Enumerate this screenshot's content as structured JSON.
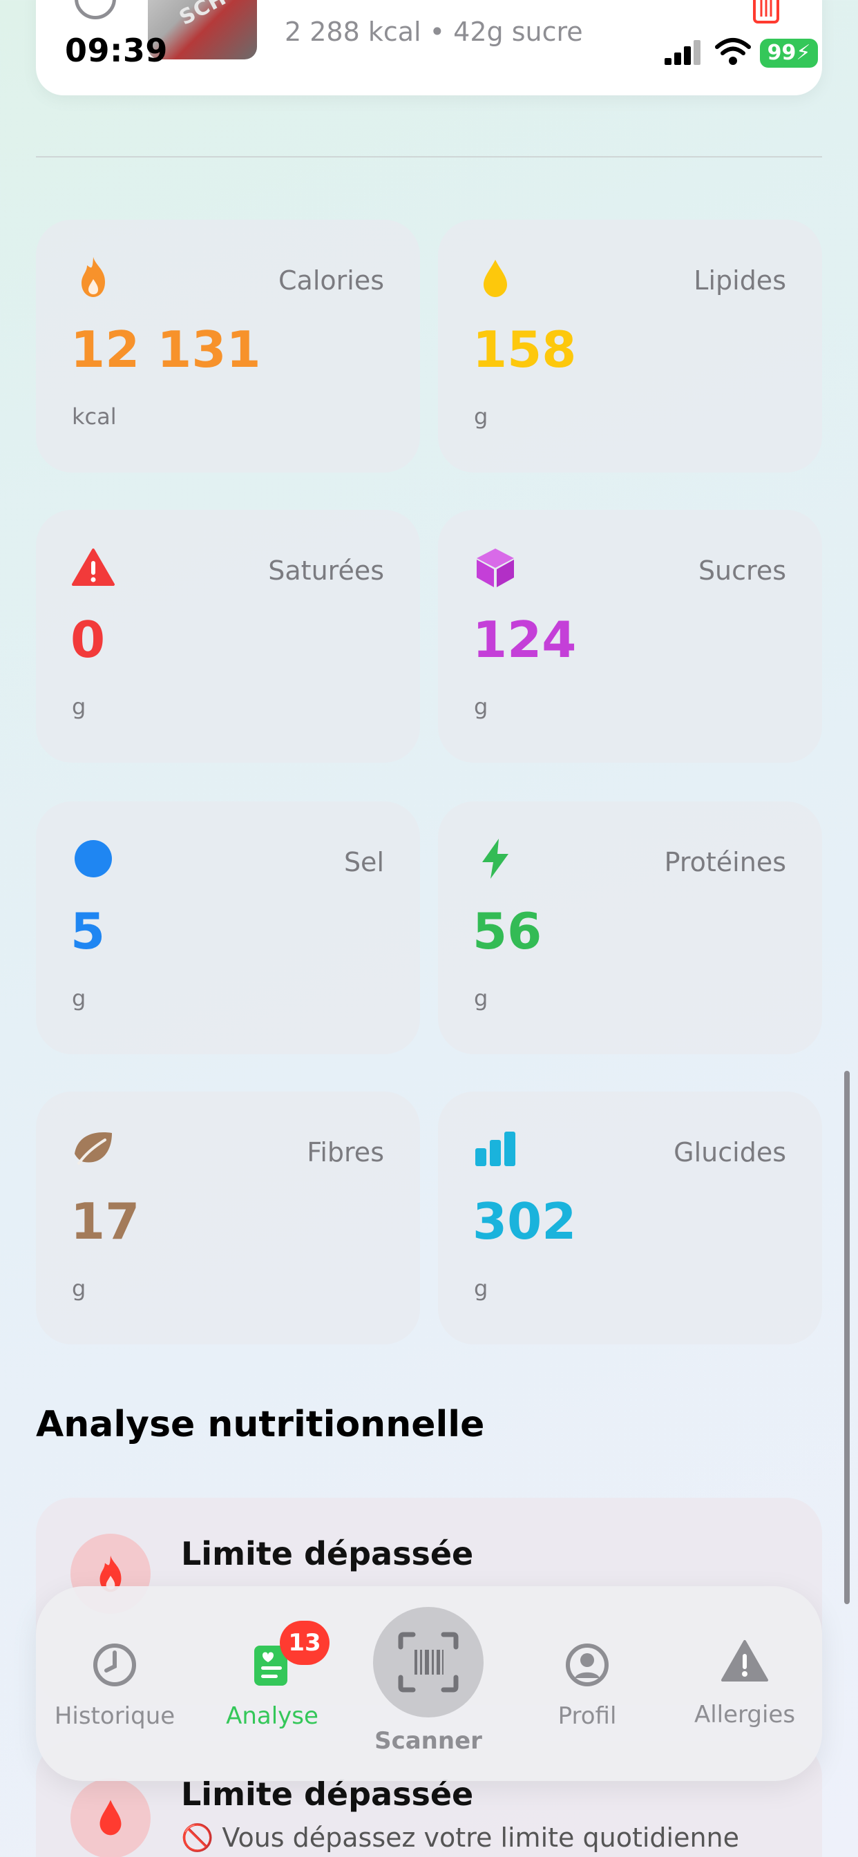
{
  "top_item": {
    "meta": "2 288 kcal • 42g sucre",
    "thumb_text": "SCH"
  },
  "status_bar": {
    "time": "09:39",
    "battery": "99"
  },
  "stats": [
    {
      "label": "Calories",
      "value": "12 131",
      "unit": "kcal",
      "color": "#f7922b",
      "icon": "flame-icon"
    },
    {
      "label": "Lipides",
      "value": "158",
      "unit": "g",
      "color": "#fdc80c",
      "icon": "drop-icon"
    },
    {
      "label": "Saturées",
      "value": "0",
      "unit": "g",
      "color": "#f23a3a",
      "icon": "warning-icon"
    },
    {
      "label": "Sucres",
      "value": "124",
      "unit": "g",
      "color": "#c43fd8",
      "icon": "cube-icon"
    },
    {
      "label": "Sel",
      "value": "5",
      "unit": "g",
      "color": "#1f86f2",
      "icon": "circle-icon"
    },
    {
      "label": "Protéines",
      "value": "56",
      "unit": "g",
      "color": "#33bb55",
      "icon": "bolt-icon"
    },
    {
      "label": "Fibres",
      "value": "17",
      "unit": "g",
      "color": "#a37b5a",
      "icon": "leaf-icon"
    },
    {
      "label": "Glucides",
      "value": "302",
      "unit": "g",
      "color": "#1ab3dc",
      "icon": "bars-icon"
    }
  ],
  "section": {
    "title": "Analyse nutritionnelle"
  },
  "analysis": [
    {
      "title": "Limite dépassée",
      "icon": "flame-icon"
    },
    {
      "title": "Limite dépassée",
      "text": "🚫 Vous dépassez votre limite quotidienne",
      "icon": "drop-icon"
    }
  ],
  "tabbar": {
    "tabs": [
      {
        "label": "Historique",
        "icon": "clock-icon"
      },
      {
        "label": "Analyse",
        "icon": "document-heart-icon",
        "badge": "13",
        "active": true
      },
      {
        "label": "Scanner",
        "icon": "barcode-scanner-icon"
      },
      {
        "label": "Profil",
        "icon": "person-circle-icon"
      },
      {
        "label": "Allergies",
        "icon": "warning-icon"
      }
    ]
  },
  "colors": {
    "accent_green": "#34c759",
    "badge_red": "#ff3b30"
  }
}
